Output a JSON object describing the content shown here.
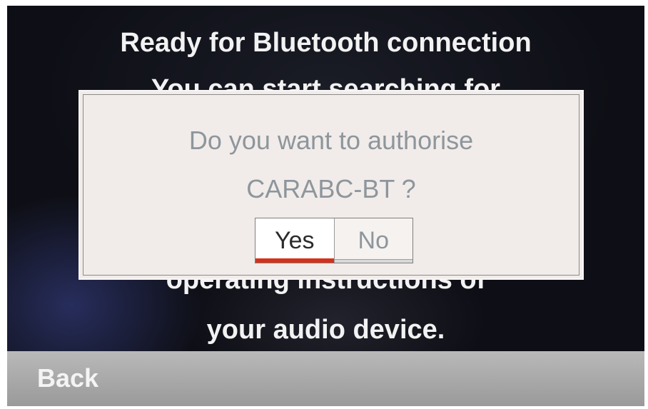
{
  "screen": {
    "title": "Ready for Bluetooth connection",
    "background_line_2": "You can start searching for",
    "background_line_3": "operating instructions of",
    "background_line_4": "your audio device."
  },
  "dialog": {
    "question_line_1": "Do you want to authorise",
    "question_line_2": "CARABC-BT ?",
    "buttons": {
      "yes_label": "Yes",
      "no_label": "No",
      "selected": "Yes"
    }
  },
  "footer": {
    "back_label": "Back"
  },
  "colors": {
    "selection_underline": "#d4311c",
    "dialog_background": "#f1ecea",
    "footer_bar": "#a8a8a8"
  }
}
